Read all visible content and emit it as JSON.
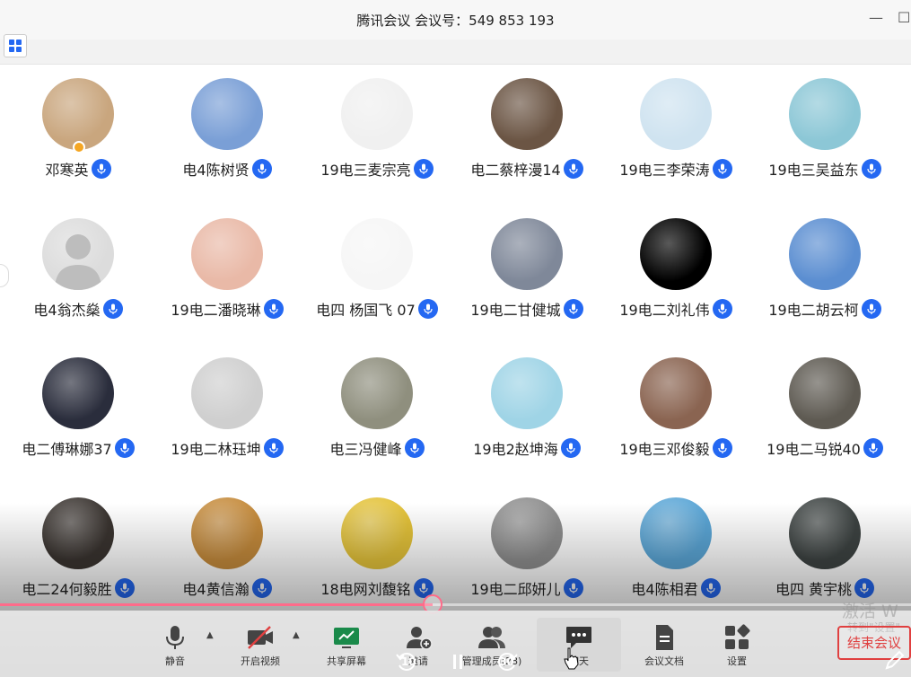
{
  "window": {
    "title": "腾讯会议 会议号：549 853 193",
    "minimize_icon": "minimize-icon",
    "maximize_icon": "maximize-icon"
  },
  "participants": [
    {
      "name": "邓寒英",
      "host": true,
      "avatar_color": "#c9a67e"
    },
    {
      "name": "电4陈树贤",
      "avatar_color": "#7a9fd6"
    },
    {
      "name": "19电三麦宗亮",
      "avatar_color": "#f0f0f0"
    },
    {
      "name": "电二蔡梓漫14",
      "avatar_color": "#6b5544"
    },
    {
      "name": "19电三李荣涛",
      "avatar_color": "#cfe3f0"
    },
    {
      "name": "19电三吴益东",
      "avatar_color": "#8cc7d6"
    },
    {
      "name": "电4翁杰燊",
      "avatar_color": "#dcdcdc"
    },
    {
      "name": "19电二潘晓琳",
      "avatar_color": "#e9b9a7"
    },
    {
      "name": "电四 杨国飞 07",
      "avatar_color": "#f6f6f6"
    },
    {
      "name": "19电二甘健城",
      "avatar_color": "#7f8899"
    },
    {
      "name": "19电二刘礼伟",
      "avatar_color": "#000000"
    },
    {
      "name": "19电二胡云柯",
      "avatar_color": "#5b8ed1"
    },
    {
      "name": "电二傅琳娜37",
      "avatar_color": "#2a2d3c"
    },
    {
      "name": "19电二林珏坤",
      "avatar_color": "#cfcfcf"
    },
    {
      "name": "电三冯健峰",
      "avatar_color": "#8f8f7e"
    },
    {
      "name": "19电2赵坤海",
      "avatar_color": "#9fd4e6"
    },
    {
      "name": "19电三邓俊毅",
      "avatar_color": "#8a6451"
    },
    {
      "name": "19电二马锐40",
      "avatar_color": "#5e5a52"
    },
    {
      "name": "电二24何毅胜",
      "avatar_color": "#3a3430"
    },
    {
      "name": "电4黄信瀚",
      "avatar_color": "#c58b3c"
    },
    {
      "name": "18电网刘馥铭",
      "avatar_color": "#e3c23a"
    },
    {
      "name": "19电二邱妍儿",
      "avatar_color": "#8e8e8e"
    },
    {
      "name": "电4陈相君",
      "avatar_color": "#5ba6d6"
    },
    {
      "name": "电四 黄宇桃",
      "avatar_color": "#3d4342"
    }
  ],
  "toolbar": {
    "mute": "静音",
    "video": "开启视频",
    "share": "共享屏幕",
    "invite": "邀请",
    "members": "管理成员(28)",
    "chat": "聊天",
    "docs": "会议文档",
    "settings": "设置"
  },
  "player": {
    "rewind_label": "10",
    "forward_label": "30",
    "progress": 0.475
  },
  "overlay": {
    "watermark": "激活 W",
    "watermark_sub": "转到\"设置\"",
    "end_meeting": "结束会议"
  },
  "colors": {
    "mic_blue": "#2468f2",
    "progress_pink": "#ff6b8a",
    "end_red": "#e04040"
  }
}
